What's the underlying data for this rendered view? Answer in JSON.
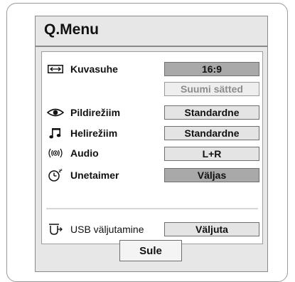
{
  "menu": {
    "title": "Q.Menu",
    "rows": {
      "aspect": {
        "label": "Kuvasuhe",
        "value": "16:9",
        "sub_value": "Suumi sätted",
        "icon": "aspect-ratio-icon"
      },
      "picture": {
        "label": "Pildirežiim",
        "value": "Standardne",
        "icon": "eye-icon"
      },
      "sound": {
        "label": "Helirežiim",
        "value": "Standardne",
        "icon": "music-note-icon"
      },
      "audio": {
        "label": "Audio",
        "value": "L+R",
        "icon": "audio-waves-icon"
      },
      "sleep": {
        "label": "Unetaimer",
        "value": "Väljas",
        "icon": "sleep-clock-icon"
      },
      "usb": {
        "label": "USB väljutamine",
        "value": "Väljuta",
        "icon": "usb-eject-icon"
      }
    },
    "close_label": "Sule"
  },
  "colors": {
    "panel": "#e7e7e7",
    "selected_button": "#a9a9a9",
    "button": "#e4e4e4",
    "border": "#8a8a8a"
  }
}
